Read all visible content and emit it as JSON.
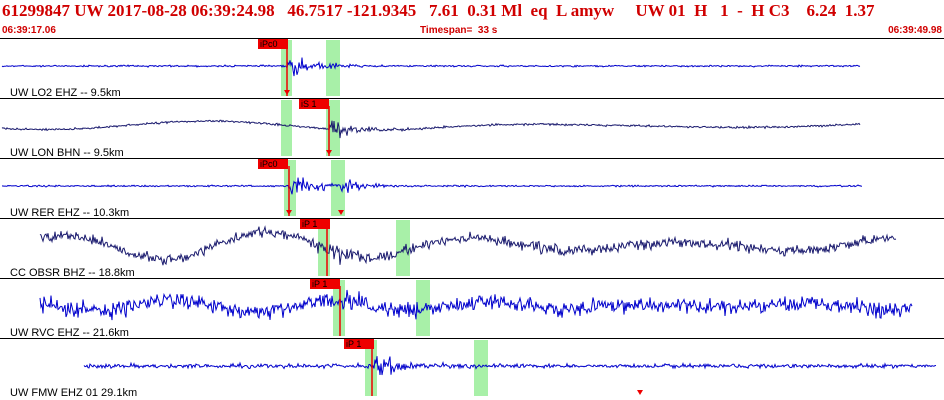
{
  "header": {
    "event_line": "61299847 UW 2017-08-28 06:39:24.98   46.7517 -121.9345   7.61  0.31 Ml  eq  L amyw     UW 01  H   1  -  H C3    6.24  1.37",
    "start_time": "06:39:17.06",
    "timespan": "Timespan=  33 s",
    "end_time": "06:39:49.98"
  },
  "colors": {
    "header_text": "#d00000",
    "trace_blue": "#0000cc",
    "trace_navy": "#1a1a6e",
    "pick_red": "#ee0000",
    "window_green": "#a8f0a8"
  },
  "traces": [
    {
      "label": "UW LO2 EHZ -- 9.5km",
      "pick_label": "iPc0",
      "color": "navy_blue",
      "amplitude": "low"
    },
    {
      "label": "UW LON BHN -- 9.5km",
      "pick_label": "iS 1",
      "color": "navy",
      "amplitude": "low"
    },
    {
      "label": "UW RER EHZ -- 10.3km",
      "pick_label": "iPc0",
      "color": "blue",
      "amplitude": "low"
    },
    {
      "label": "CC OBSR BHZ -- 18.8km",
      "pick_label": "iP 1",
      "color": "navy",
      "amplitude": "high"
    },
    {
      "label": "UW RVC EHZ -- 21.6km",
      "pick_label": "iP 1",
      "color": "blue",
      "amplitude": "high"
    },
    {
      "label": "UW FMW EHZ 01 29.1km",
      "pick_label": "iP 1",
      "color": "blue",
      "amplitude": "medium"
    }
  ]
}
